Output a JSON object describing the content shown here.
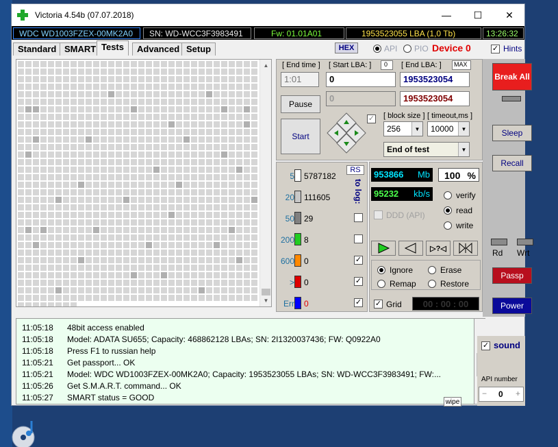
{
  "window": {
    "title": "Victoria 4.54b (07.07.2018)",
    "minimize": "—",
    "maximize": "☐",
    "close": "✕"
  },
  "infobar": {
    "model": "WDC WD1003FZEX-00MK2A0",
    "serial": "SN: WD-WCC3F3983491",
    "firmware": "Fw: 01.01A01",
    "lba": "1953523055 LBA (1,0 Tb)",
    "clock": "13:26:32"
  },
  "tabs": [
    "Standard",
    "SMART",
    "Tests",
    "Advanced",
    "Setup"
  ],
  "toolbar": {
    "hex": "HEX",
    "api": "API",
    "pio": "PIO",
    "device": "Device 0",
    "hints": "Hints"
  },
  "tests": {
    "end_time_label": "[ End time ]",
    "end_time": "1:01",
    "start_lba_label": "[ Start LBA: ]",
    "start_lba_badge": "0",
    "start_lba": "0",
    "start_lba_2": "0",
    "end_lba_label": "[ End LBA: ]",
    "end_lba_max": "MAX",
    "end_lba": "1953523054",
    "end_lba_2": "1953523054",
    "pause": "Pause",
    "start": "Start",
    "block_size_label": "[ block size ]",
    "block_size": "256",
    "timeout_label": "[ timeout,ms ]",
    "timeout": "10000",
    "end_action": "End of test"
  },
  "stats": {
    "rs": "RS",
    "to_log": "to log:",
    "rows": [
      {
        "label": "5",
        "value": "5787182",
        "color": "#ffffff",
        "checked": ""
      },
      {
        "label": "20",
        "value": "111605",
        "color": "#c8c8c8",
        "checked": ""
      },
      {
        "label": "50",
        "value": "29",
        "color": "#808080",
        "checked": ""
      },
      {
        "label": "200",
        "value": "8",
        "color": "#22cc22",
        "checked": ""
      },
      {
        "label": "600",
        "value": "0",
        "color": "#ff8800",
        "checked": "✓"
      },
      {
        "label": ">",
        "value": "0",
        "color": "#dd0000",
        "checked": "✓"
      },
      {
        "label": "Err",
        "value": "0",
        "color": "#0000ff",
        "checked": "✓"
      }
    ]
  },
  "progress": {
    "mb": "953866",
    "mb_unit": "Mb",
    "percent": "100",
    "percent_unit": "%",
    "speed": "95232",
    "speed_unit": "kb/s",
    "ddd": "DDD (API)",
    "verify": "verify",
    "read": "read",
    "write": "write"
  },
  "actions": {
    "ignore": "Ignore",
    "erase": "Erase",
    "remap": "Remap",
    "restore": "Restore",
    "grid": "Grid",
    "timer": "00 : 00 : 00"
  },
  "side": {
    "break": "Break All",
    "sleep": "Sleep",
    "recall": "Recall",
    "rd": "Rd",
    "wrt": "Wrt",
    "passp": "Passp",
    "power": "Power",
    "sound": "sound",
    "api_number_label": "API number",
    "api_number": "0"
  },
  "log": [
    {
      "time": "11:05:18",
      "text": "48bit access enabled"
    },
    {
      "time": "11:05:18",
      "text": "Model: ADATA SU655; Capacity: 468862128 LBAs; SN: 2I1320037436; FW: Q0922A0"
    },
    {
      "time": "11:05:18",
      "text": "Press F1 to russian help"
    },
    {
      "time": "11:05:21",
      "text": "Get passport... OK"
    },
    {
      "time": "11:05:21",
      "text": "Model: WDC WD1003FZEX-00MK2A0; Capacity: 1953523055 LBAs; SN: WD-WCC3F3983491; FW:..."
    },
    {
      "time": "11:05:26",
      "text": "Get S.M.A.R.T. command... OK"
    },
    {
      "time": "11:05:27",
      "text": "SMART status = GOOD"
    }
  ],
  "wipe": "wipe"
}
